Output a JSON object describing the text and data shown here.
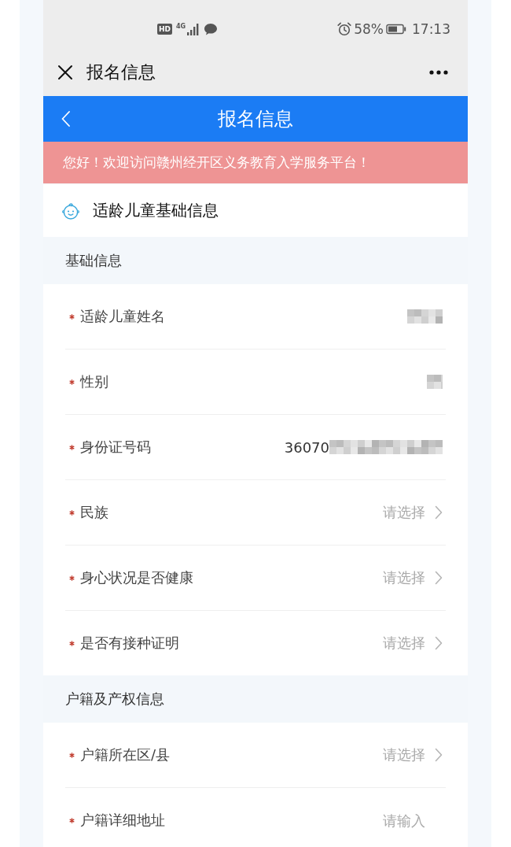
{
  "status_bar": {
    "hd_badge": "HD",
    "network_type": "4G",
    "battery_percent": "58%",
    "time": "17:13"
  },
  "title_bar": {
    "title": "报名信息"
  },
  "header": {
    "title": "报名信息"
  },
  "notice": "您好！欢迎访问赣州经开区义务教育入学服务平台！",
  "section_card": {
    "title": "适龄儿童基础信息"
  },
  "groups": [
    {
      "title": "基础信息",
      "fields": [
        {
          "label": "适龄儿童姓名",
          "required": true,
          "kind": "text",
          "mask": {
            "kind": "medium"
          }
        },
        {
          "label": "性别",
          "required": true,
          "kind": "text",
          "mask": {
            "kind": "short"
          }
        },
        {
          "label": "身份证号码",
          "required": true,
          "kind": "text",
          "value": "36070",
          "mask": {
            "kind": "long"
          }
        },
        {
          "label": "民族",
          "required": true,
          "kind": "select",
          "placeholder": "请选择"
        },
        {
          "label": "身心状况是否健康",
          "required": true,
          "kind": "select",
          "placeholder": "请选择"
        },
        {
          "label": "是否有接种证明",
          "required": true,
          "kind": "select",
          "placeholder": "请选择"
        }
      ]
    },
    {
      "title": "户籍及产权信息",
      "fields": [
        {
          "label": "户籍所在区/县",
          "required": true,
          "kind": "select",
          "placeholder": "请选择"
        },
        {
          "label": "户籍详细地址",
          "required": true,
          "kind": "input",
          "placeholder": "请输入"
        }
      ]
    }
  ]
}
